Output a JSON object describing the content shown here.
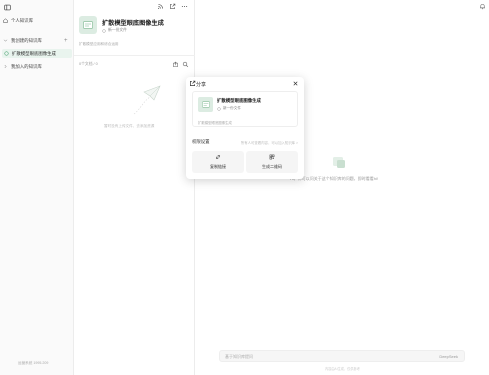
{
  "sidebar": {
    "user_name": "个人知识库",
    "groups": [
      {
        "label": "我创建的知识库"
      },
      {
        "label": "我加入的知识库"
      }
    ],
    "active_item": "扩散模型眼底图像生成",
    "add_label": "+",
    "footer": "运营系统 1995.209"
  },
  "kb_panel": {
    "title": "扩散模型眼底图像生成",
    "meta": "新一份文件",
    "description": "扩散模型应用和综合运用",
    "files_count": "0个文档 / 0",
    "empty_hint": "暂时没有上传文件，去添加资源"
  },
  "main": {
    "empty_text": "Hi，你可以问关于这个知识库的问题，即时看看hi!",
    "input_placeholder": "基于知识库提问",
    "model_label": "DeepSeek",
    "footer_note": "内容由AI生成，仅供参考"
  },
  "share_modal": {
    "title": "分享",
    "card_title": "扩散模型眼底图像生成",
    "card_meta": "新一份文件",
    "card_desc": "扩散模型眼底图像生成",
    "permission_label": "权限设置",
    "permission_value": "所有人可查看内容，可以加入知识库 >",
    "copy_link_label": "复制链接",
    "qr_label": "生成二维码"
  },
  "colors": {
    "accent_bg": "#e9f4ee",
    "thumb_bg": "#dcece2",
    "modal_shadow": "rgba(0,0,0,0.18)"
  }
}
